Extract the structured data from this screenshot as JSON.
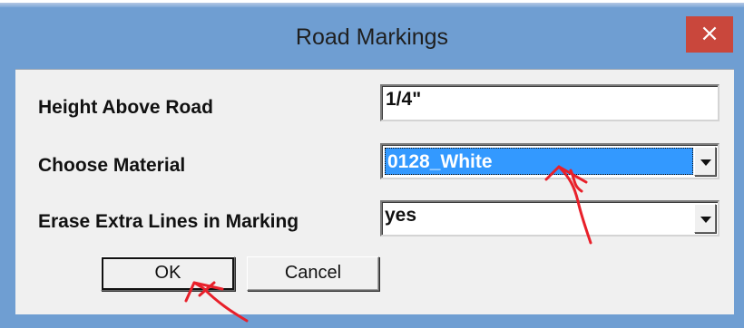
{
  "window": {
    "title": "Road Markings",
    "close_glyph": "×",
    "colors": {
      "frame": "#6f9ed2",
      "close_button": "#c9473c",
      "selection": "#3399ff",
      "annotation": "#e8202a"
    }
  },
  "form": {
    "height": {
      "label": "Height Above Road",
      "value": "1/4\""
    },
    "material": {
      "label": "Choose Material",
      "selected": "0128_White"
    },
    "erase": {
      "label": "Erase Extra Lines in Marking",
      "selected": "yes"
    }
  },
  "buttons": {
    "ok": "OK",
    "cancel": "Cancel"
  },
  "annotations": {
    "icon": "hand-drawn-red-arrow",
    "targets": [
      "material-select",
      "ok-button"
    ]
  }
}
